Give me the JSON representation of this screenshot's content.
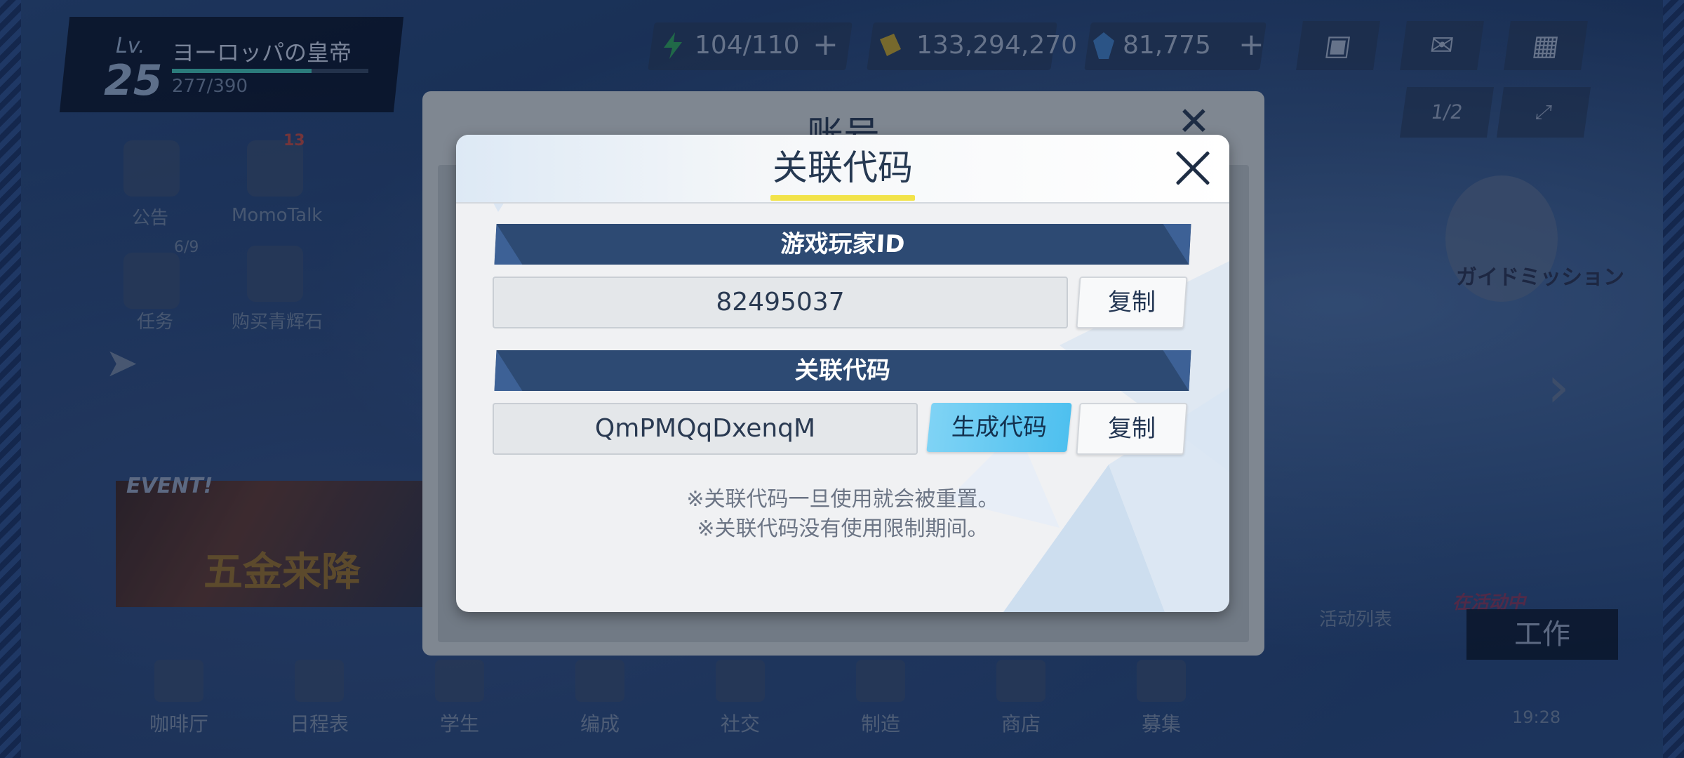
{
  "hud": {
    "level_label": "Lv.",
    "level": "25",
    "player_name": "ヨーロッパの皇帝",
    "exp_text": "277/390",
    "exp_fraction": 0.71,
    "stamina": "104/110",
    "credits": "133,294,270",
    "gems": "81,775",
    "page_indicator": "1/2"
  },
  "side_menu": {
    "notice": "公告",
    "momotalk": "MomoTalk",
    "momotalk_badge": "13",
    "tasks": "任务",
    "tasks_badge": "6/9",
    "shop": "购买青辉石"
  },
  "event_banner": {
    "label": "EVENT!",
    "title": "五金来降"
  },
  "right_side": {
    "guide_mission": "ガイドミッション",
    "activity_list": "活动列表",
    "in_progress": "在活动中",
    "work": "工作"
  },
  "bottom_nav": {
    "items": [
      "咖啡厅",
      "日程表",
      "学生",
      "编成",
      "社交",
      "制造",
      "商店",
      "募集"
    ]
  },
  "clock": "19:28",
  "account_panel": {
    "title": "账号"
  },
  "dialog": {
    "title": "关联代码",
    "player_id_header": "游戏玩家ID",
    "player_id": "82495037",
    "copy_label": "复制",
    "link_code_header": "关联代码",
    "link_code": "QmPMQqDxenqM",
    "generate_label": "生成代码",
    "note1": "※关联代码一旦使用就会被重置。",
    "note2": "※关联代码没有使用限制期间。"
  },
  "colors": {
    "header_bar": "#2d4a73",
    "generate_button": "#4ec0ef",
    "title_underline": "#f2e34a"
  }
}
